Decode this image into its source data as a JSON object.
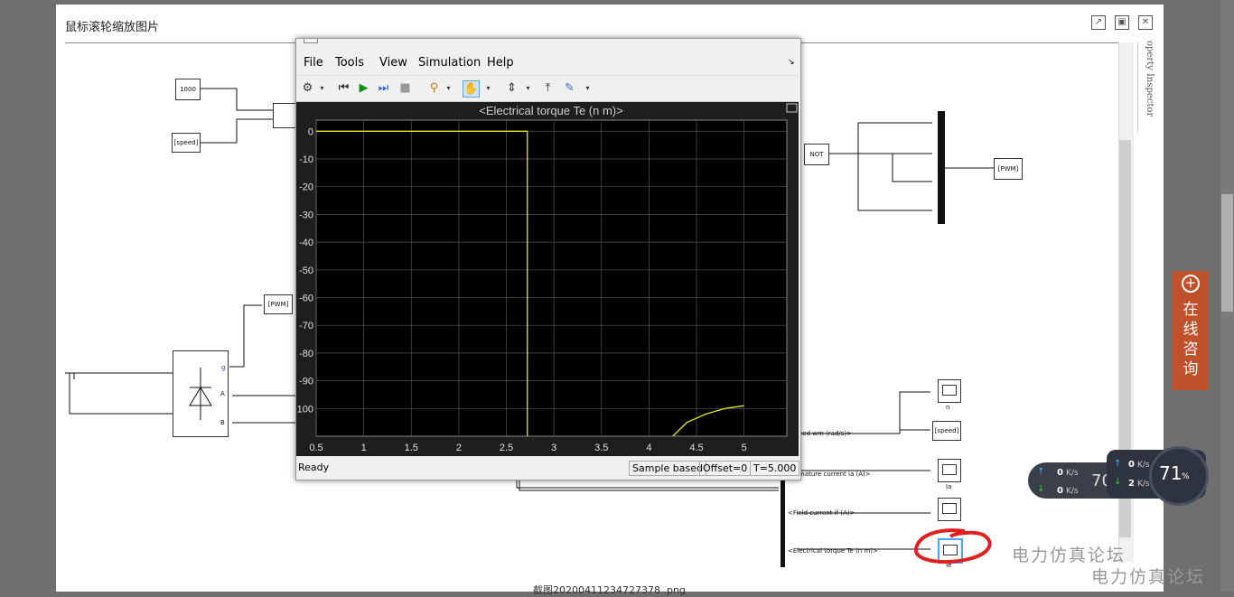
{
  "dialog": {
    "title": "鼠标滚轮缩放图片",
    "filename": "截图20200411234727378 .png",
    "property_inspector": "operty Inspector"
  },
  "diagram": {
    "const_value": "1000",
    "goto_speed_left": "[speed]",
    "from_pwm_left": "[PWM]",
    "not_block": "NOT",
    "goto_pwm_right": "[PWM]",
    "port_g": "g",
    "port_a": "A",
    "port_b": "B",
    "scope_n": "n",
    "goto_speed_right": "[speed]",
    "scope_ia": "Ia",
    "scope_te": "Te",
    "sig_speed": "eed wm (rad/s)>",
    "sig_armature": "mature current ia (A)>",
    "sig_field": "<Field current if (A)>",
    "sig_torque": "<Electrical torque Te (n m)>"
  },
  "scope": {
    "menus": [
      "File",
      "Tools",
      "View",
      "Simulation",
      "Help"
    ],
    "status": "Ready",
    "sample_mode": "Sample based",
    "offset": "Offset=0",
    "time": "T=5.000"
  },
  "chart_data": {
    "type": "line",
    "title": "<Electrical torque Te (n m)>",
    "xlabel": "",
    "ylabel": "",
    "xlim": [
      0.5,
      5.45
    ],
    "ylim": [
      -110,
      4
    ],
    "x_ticks": [
      0.5,
      1,
      1.5,
      2,
      2.5,
      3,
      3.5,
      4,
      4.5,
      5
    ],
    "y_ticks": [
      0,
      -10,
      -20,
      -30,
      -40,
      -50,
      -60,
      -70,
      -80,
      -90,
      -100
    ],
    "grid": true,
    "series": [
      {
        "color": "#e6e619",
        "x": [
          0.5,
          2.72,
          2.72,
          2.72
        ],
        "y": [
          0,
          0,
          -50,
          -110
        ]
      },
      {
        "color": "#e6e619",
        "x": [
          4.25,
          4.4,
          4.6,
          4.8,
          5.0
        ],
        "y": [
          -110,
          -105,
          -102,
          -100,
          -99
        ]
      }
    ],
    "colors": {
      "background": "#000000",
      "grid": "#555555",
      "line": "#e6e619"
    }
  },
  "widgets": {
    "consult": "在线咨询",
    "watermark": "电力仿真论坛",
    "net_up1": "0",
    "net_down1": "0",
    "net_unit": "K/s",
    "net_up2": "0",
    "net_down2": "2",
    "cpu": "71",
    "cpu_unit": "%",
    "partial_num": "70"
  }
}
